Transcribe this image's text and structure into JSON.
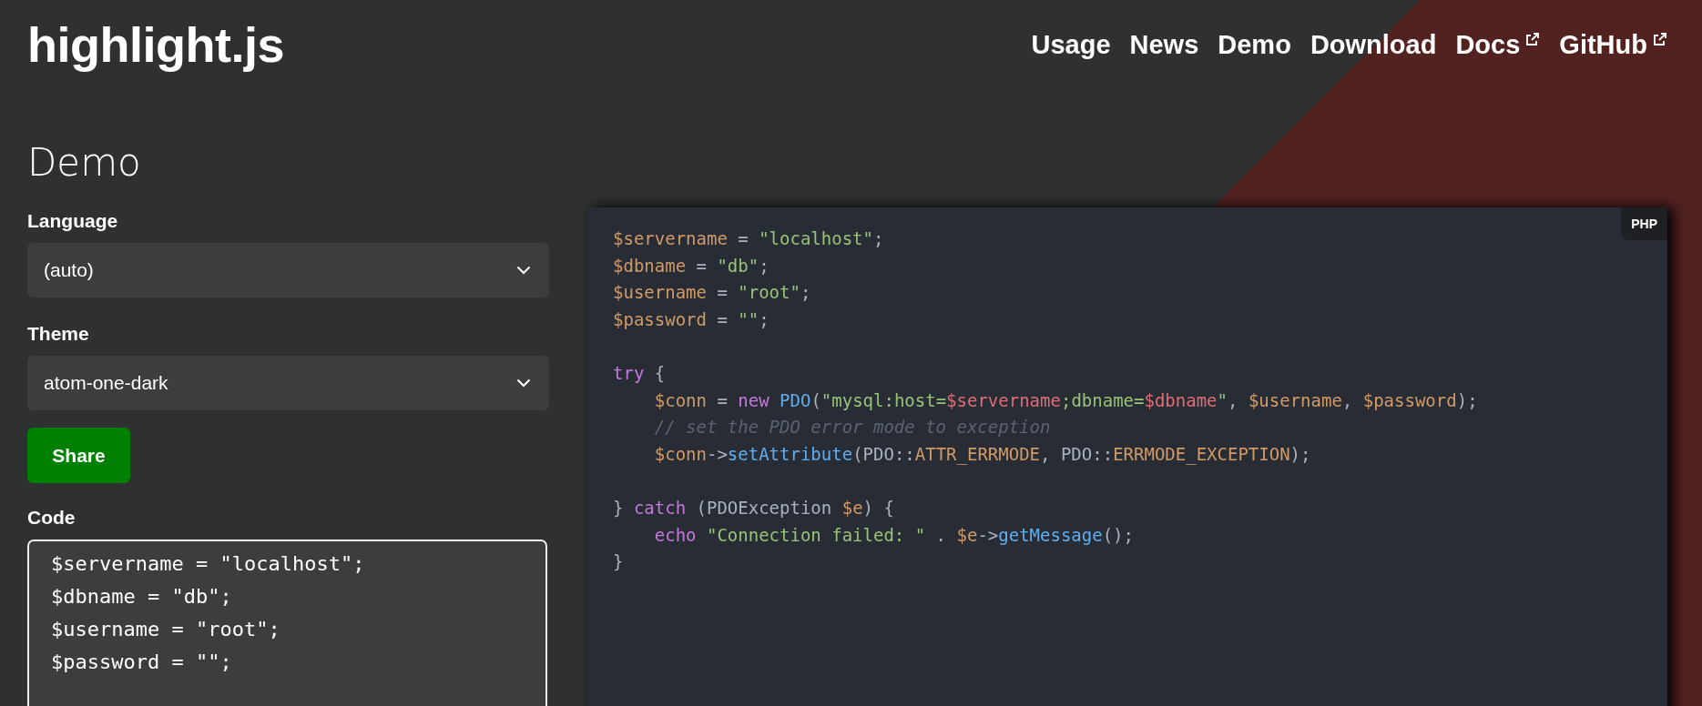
{
  "logo": "highlight.js",
  "nav": [
    {
      "label": "Usage",
      "external": false
    },
    {
      "label": "News",
      "external": false
    },
    {
      "label": "Demo",
      "external": false
    },
    {
      "label": "Download",
      "external": false
    },
    {
      "label": "Docs",
      "external": true
    },
    {
      "label": "GitHub",
      "external": true
    }
  ],
  "heading": "Demo",
  "language": {
    "label": "Language",
    "value": "(auto)"
  },
  "theme": {
    "label": "Theme",
    "value": "atom-one-dark"
  },
  "share_button": "Share",
  "code_input": {
    "label": "Code",
    "lines": [
      "$servername = \"localhost\";",
      "$dbname = \"db\";",
      "$username = \"root\";",
      "$password = \"\";"
    ]
  },
  "preview": {
    "language_badge": "PHP",
    "blocks": [
      [
        [
          {
            "text": "$servername",
            "kind": "variable"
          },
          {
            "text": " = ",
            "kind": "plain"
          },
          {
            "text": "\"localhost\"",
            "kind": "string"
          },
          {
            "text": ";",
            "kind": "plain"
          }
        ],
        [
          {
            "text": "$dbname",
            "kind": "variable"
          },
          {
            "text": " = ",
            "kind": "plain"
          },
          {
            "text": "\"db\"",
            "kind": "string"
          },
          {
            "text": ";",
            "kind": "plain"
          }
        ],
        [
          {
            "text": "$username",
            "kind": "variable"
          },
          {
            "text": " = ",
            "kind": "plain"
          },
          {
            "text": "\"root\"",
            "kind": "string"
          },
          {
            "text": ";",
            "kind": "plain"
          }
        ],
        [
          {
            "text": "$password",
            "kind": "variable"
          },
          {
            "text": " = ",
            "kind": "plain"
          },
          {
            "text": "\"\"",
            "kind": "string"
          },
          {
            "text": ";",
            "kind": "plain"
          }
        ]
      ],
      [
        [
          {
            "text": "try",
            "kind": "keyword"
          },
          {
            "text": " {",
            "kind": "plain"
          }
        ],
        [
          {
            "text": "    $conn",
            "kind": "variable"
          },
          {
            "text": " = ",
            "kind": "plain"
          },
          {
            "text": "new ",
            "kind": "keyword"
          },
          {
            "text": "PDO",
            "kind": "function"
          },
          {
            "text": "(",
            "kind": "plain"
          },
          {
            "text": "\"mysql:host=",
            "kind": "string"
          },
          {
            "text": "$servername",
            "kind": "subst"
          },
          {
            "text": ";dbname=",
            "kind": "string"
          },
          {
            "text": "$dbname",
            "kind": "subst"
          },
          {
            "text": "\"",
            "kind": "string"
          },
          {
            "text": ", ",
            "kind": "plain"
          },
          {
            "text": "$username",
            "kind": "variable"
          },
          {
            "text": ", ",
            "kind": "plain"
          },
          {
            "text": "$password",
            "kind": "variable"
          },
          {
            "text": ");",
            "kind": "plain"
          }
        ],
        [
          {
            "text": "    // set the PDO error mode to exception",
            "kind": "comment"
          }
        ],
        [
          {
            "text": "    $conn",
            "kind": "variable"
          },
          {
            "text": "->",
            "kind": "plain"
          },
          {
            "text": "setAttribute",
            "kind": "function"
          },
          {
            "text": "(PDO::",
            "kind": "plain"
          },
          {
            "text": "ATTR_ERRMODE",
            "kind": "variable"
          },
          {
            "text": ", PDO::",
            "kind": "plain"
          },
          {
            "text": "ERRMODE_EXCEPTION",
            "kind": "variable"
          },
          {
            "text": ");",
            "kind": "plain"
          }
        ]
      ],
      [
        [
          {
            "text": "} ",
            "kind": "plain"
          },
          {
            "text": "catch",
            "kind": "keyword"
          },
          {
            "text": " (PDOException ",
            "kind": "plain"
          },
          {
            "text": "$e",
            "kind": "variable"
          },
          {
            "text": ") {",
            "kind": "plain"
          }
        ],
        [
          {
            "text": "    echo ",
            "kind": "keyword"
          },
          {
            "text": "\"Connection failed: \"",
            "kind": "string"
          },
          {
            "text": " . ",
            "kind": "plain"
          },
          {
            "text": "$e",
            "kind": "variable"
          },
          {
            "text": "->",
            "kind": "plain"
          },
          {
            "text": "getMessage",
            "kind": "function"
          },
          {
            "text": "();",
            "kind": "plain"
          }
        ],
        [
          {
            "text": "}",
            "kind": "plain"
          }
        ]
      ]
    ]
  }
}
